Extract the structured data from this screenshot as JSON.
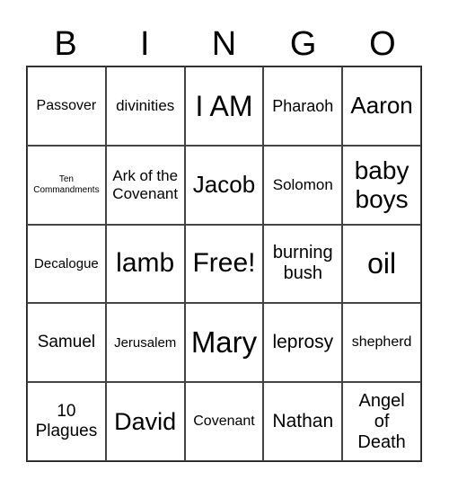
{
  "header": [
    "B",
    "I",
    "N",
    "G",
    "O"
  ],
  "cells": [
    "Passover",
    "divinities",
    "I AM",
    "Pharaoh",
    "Aaron",
    "Ten Commandments",
    "Ark of the Covenant",
    "Jacob",
    "Solomon",
    "baby boys",
    "Decalogue",
    "lamb",
    "Free!",
    "burning bush",
    "oil",
    "Samuel",
    "Jerusalem",
    "Mary",
    "leprosy",
    "shepherd",
    "10 Plagues",
    "David",
    "Covenant",
    "Nathan",
    "Angel of Death"
  ]
}
